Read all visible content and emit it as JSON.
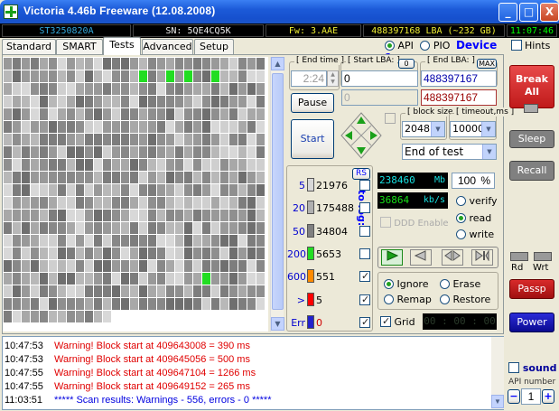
{
  "window": {
    "title": "Victoria 4.46b Freeware (12.08.2008)",
    "btn_min": "_",
    "btn_max": "□",
    "btn_close": "X"
  },
  "status": {
    "model": "ST3250820A",
    "serial": "SN: 5QE4CQ5K",
    "firmware": "Fw: 3.AAE",
    "lba": "488397168 LBA (~232 GB)",
    "time": "11:07:46"
  },
  "tabs": {
    "standard": "Standard",
    "smart": "SMART",
    "tests": "Tests",
    "advanced": "Advanced",
    "setup": "Setup"
  },
  "header": {
    "api": "API",
    "pio": "PIO",
    "device": "Device 1",
    "hints": "Hints"
  },
  "tests": {
    "end_time_label": "End time",
    "end_time_value": "2:24",
    "start_lba_label": "Start LBA:",
    "start_lba_reset": "0",
    "end_lba_label": "End LBA:",
    "end_lba_max": "MAX",
    "start_lba": "0",
    "end_lba": "488397167",
    "current_lba": "0",
    "current_end_lba": "488397167",
    "pause": "Pause",
    "start": "Start",
    "block_size_label": "block size",
    "block_size": "2048",
    "timeout_label": "timeout,ms",
    "timeout": "10000",
    "end_action": "End of test",
    "rs": "RS",
    "to_log": "to log:",
    "timing": [
      {
        "label": "5",
        "count": "21976",
        "color": "#d8d8d8",
        "log": false
      },
      {
        "label": "20",
        "count": "175488",
        "color": "#b0b0b0",
        "log": false
      },
      {
        "label": "50",
        "count": "34804",
        "color": "#808080",
        "log": false
      },
      {
        "label": "200",
        "count": "5653",
        "color": "#22dd22",
        "log": false
      },
      {
        "label": "600",
        "count": "551",
        "color": "#ff8a00",
        "log": true
      },
      {
        "label": ">",
        "count": "5",
        "color": "#ff0000",
        "log": true
      },
      {
        "label": "Err",
        "count": "0",
        "color": "#2222cc",
        "log": true
      }
    ],
    "mb": "238460",
    "mb_unit": "Mb",
    "percent": "100",
    "percent_unit": "%",
    "speed": "36864",
    "speed_unit": "kb/s",
    "verify": "verify",
    "read": "read",
    "write": "write",
    "ddd": "DDD Enable",
    "ignore": "Ignore",
    "erase": "Erase",
    "remap": "Remap",
    "restore": "Restore",
    "grid": "Grid",
    "timer": "00 : 00 : 00"
  },
  "log": [
    {
      "time": "10:47:53",
      "text": "Warning! Block start at 409643008 = 390 ms",
      "color": "#e00000"
    },
    {
      "time": "10:47:53",
      "text": "Warning! Block start at 409645056 = 500 ms",
      "color": "#e00000"
    },
    {
      "time": "10:47:55",
      "text": "Warning! Block start at 409647104 = 1266 ms",
      "color": "#e00000"
    },
    {
      "time": "10:47:55",
      "text": "Warning! Block start at 409649152 = 265 ms",
      "color": "#e00000"
    },
    {
      "time": "11:03:51",
      "text": "***** Scan results: Warnings - 556, errors - 0 *****",
      "color": "#0000e0"
    }
  ],
  "right": {
    "break": "Break All",
    "sleep": "Sleep",
    "recall": "Recall",
    "rd": "Rd",
    "wrt": "Wrt",
    "passp": "Passp",
    "power": "Power",
    "sound": "sound",
    "api_number_label": "API number",
    "api_number": "1",
    "minus": "−",
    "plus": "+"
  }
}
